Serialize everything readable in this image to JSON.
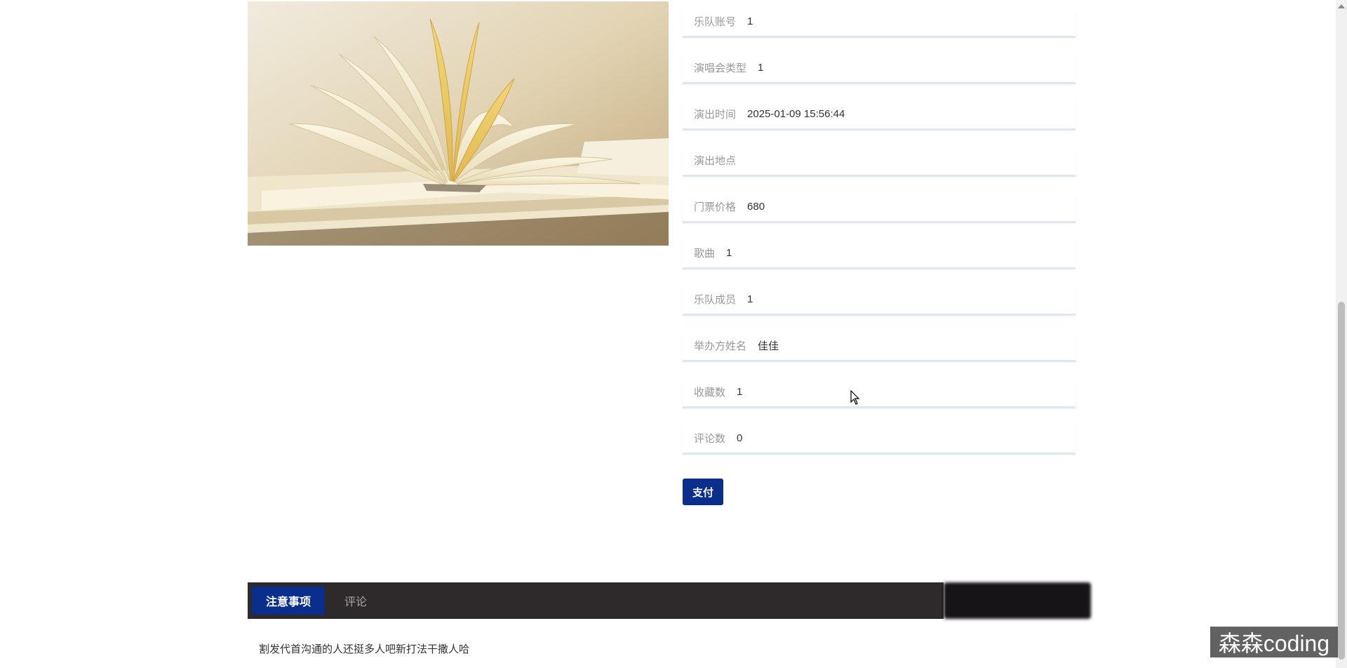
{
  "details": {
    "fields": [
      {
        "label": "乐队账号",
        "value": "1"
      },
      {
        "label": "演唱会类型",
        "value": "1"
      },
      {
        "label": "演出时间",
        "value": "2025-01-09 15:56:44"
      },
      {
        "label": "演出地点",
        "value": ""
      },
      {
        "label": "门票价格",
        "value": "680"
      },
      {
        "label": "歌曲",
        "value": "1"
      },
      {
        "label": "乐队成员",
        "value": "1"
      },
      {
        "label": "举办方姓名",
        "value": "佳佳"
      },
      {
        "label": "收藏数",
        "value": "1"
      },
      {
        "label": "评论数",
        "value": "0"
      }
    ],
    "pay_label": "支付"
  },
  "tabs": [
    {
      "label": "注意事项",
      "active": true
    },
    {
      "label": "评论",
      "active": false
    }
  ],
  "notice": {
    "text": "割发代首沟通的人还挺多人吧新打法干撒人哈"
  },
  "watermark": {
    "text": "森森coding"
  },
  "colors": {
    "accent": "#0a2e8c",
    "tab_bar": "#2e2a2c",
    "field_border": "#dfe8f2"
  },
  "image": {
    "icon": "open-books-image"
  }
}
